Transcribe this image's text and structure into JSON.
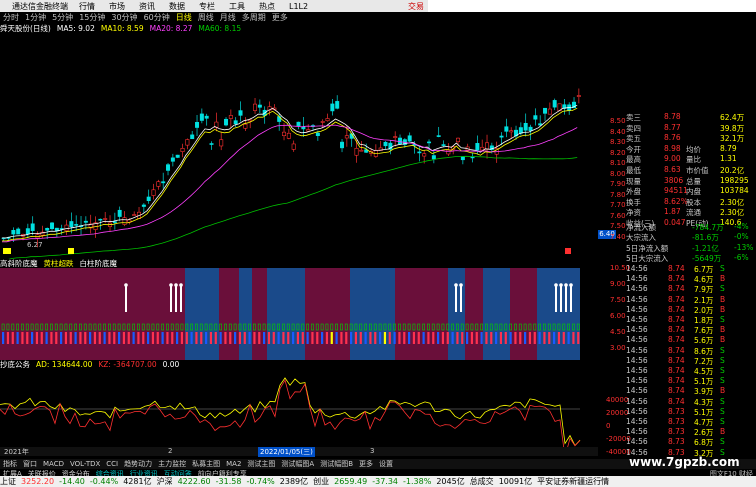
{
  "menubar": {
    "logo": "通达信金融终端",
    "items": [
      "行情",
      "市场",
      "资讯",
      "数据",
      "专栏",
      "工具",
      "热点",
      "L1L2"
    ],
    "login": "交易"
  },
  "periods": [
    "分时",
    "1分钟",
    "5分钟",
    "15分钟",
    "30分钟",
    "60分钟",
    "日线",
    "周线",
    "月线",
    "多周期",
    "更多"
  ],
  "active_period": "日线",
  "stock": {
    "title": "舜天股份(日线)",
    "ma5": "MA5: 9.02",
    "ma10": "MA10: 8.59",
    "ma20": "MA20: 8.27",
    "ma60": "MA60: 8.15",
    "low_label": "6.27"
  },
  "price_axis": [
    "8.50",
    "8.40",
    "8.30",
    "8.20",
    "8.10",
    "8.00",
    "7.90",
    "7.80",
    "7.70",
    "7.60",
    "7.50",
    "7.40"
  ],
  "last_price_tag": "6.40",
  "indicator1": {
    "title": "高斜阶底魔",
    "legend1": "黄柱超跌",
    "legend2": "白柱阶底魔",
    "axis": [
      "10.50",
      "9.00",
      "7.50",
      "6.00",
      "4.50",
      "3.00"
    ]
  },
  "indicator2": {
    "title": "抄底公务",
    "ad": "AD: 134644.00",
    "adz": "KZ: -364707.00",
    "z": "0.00",
    "axis": [
      "40000",
      "20000",
      "0",
      "-20000",
      "-40000"
    ]
  },
  "date_axis": [
    "2021年",
    "2",
    "2022/01/05(三)",
    "3"
  ],
  "quote": {
    "rows": [
      {
        "l": "卖三",
        "v": "8.78",
        "r": "",
        "n": "62.4万"
      },
      {
        "l": "卖四",
        "v": "8.77",
        "r": "",
        "n": "39.8万"
      },
      {
        "l": "卖五",
        "v": "8.76",
        "r": "",
        "n": "32.1万"
      },
      {
        "l": "今开",
        "v": "8.98",
        "r": "均价",
        "n": "8.79"
      },
      {
        "l": "最高",
        "v": "9.00",
        "r": "量比",
        "n": "1.31"
      },
      {
        "l": "最低",
        "v": "8.63",
        "r": "市价值",
        "n": "20.2亿"
      },
      {
        "l": "现量",
        "v": "3806",
        "r": "总量",
        "n": "198295"
      },
      {
        "l": "外盘",
        "v": "94511",
        "r": "内盘",
        "n": "103784"
      },
      {
        "l": "换手",
        "v": "8.62%",
        "r": "股本",
        "n": "2.30亿"
      },
      {
        "l": "净资",
        "v": "1.87",
        "r": "流通",
        "n": "2.30亿"
      },
      {
        "l": "收益(三)",
        "v": "0.047",
        "r": "PE(动)",
        "n": "140.6"
      }
    ],
    "flows": [
      {
        "l": "净流入额",
        "v": "-784.7万",
        "p": "-4%"
      },
      {
        "l": "大宗流入",
        "v": "-81.6万",
        "p": "-0%"
      },
      {
        "l": "5日净流入额",
        "v": "-1.21亿",
        "p": "-13%"
      },
      {
        "l": "5日大宗流入",
        "v": "-5649万",
        "p": "-6%"
      }
    ],
    "ticks": [
      {
        "t": "14:56",
        "p": "8.74",
        "v": "6.7万",
        "d": "S"
      },
      {
        "t": "14:56",
        "p": "8.74",
        "v": "4.6万",
        "d": "B"
      },
      {
        "t": "14:56",
        "p": "8.74",
        "v": "7.9万",
        "d": "S"
      },
      {
        "t": "14:56",
        "p": "8.74",
        "v": "2.1万",
        "d": "B"
      },
      {
        "t": "14:56",
        "p": "8.74",
        "v": "2.0万",
        "d": "B"
      },
      {
        "t": "14:56",
        "p": "8.74",
        "v": "1.8万",
        "d": "S"
      },
      {
        "t": "14:56",
        "p": "8.74",
        "v": "7.6万",
        "d": "B"
      },
      {
        "t": "14:56",
        "p": "8.74",
        "v": "5.6万",
        "d": "B"
      },
      {
        "t": "14:56",
        "p": "8.74",
        "v": "8.6万",
        "d": "S"
      },
      {
        "t": "14:56",
        "p": "8.74",
        "v": "7.2万",
        "d": "S"
      },
      {
        "t": "14:56",
        "p": "8.74",
        "v": "4.5万",
        "d": "S"
      },
      {
        "t": "14:56",
        "p": "8.74",
        "v": "5.1万",
        "d": "S"
      },
      {
        "t": "14:56",
        "p": "8.74",
        "v": "3.9万",
        "d": "B"
      },
      {
        "t": "14:56",
        "p": "8.74",
        "v": "4.3万",
        "d": "S"
      },
      {
        "t": "14:56",
        "p": "8.73",
        "v": "5.1万",
        "d": "S"
      },
      {
        "t": "14:56",
        "p": "8.73",
        "v": "4.7万",
        "d": "S"
      },
      {
        "t": "14:56",
        "p": "8.73",
        "v": "2.6万",
        "d": "B"
      },
      {
        "t": "14:56",
        "p": "8.73",
        "v": "6.8万",
        "d": "S"
      },
      {
        "t": "14:56",
        "p": "8.73",
        "v": "3.2万",
        "d": "S"
      }
    ]
  },
  "taskbar": [
    "指标",
    "窗口",
    "MACD",
    "VOL-TDX",
    "CCI",
    "趋势动力",
    "主力监控",
    "私募主图",
    "MA2",
    "测试主图",
    "测试幅图A",
    "测试幅图B",
    "更多",
    "设置"
  ],
  "taskbar2": [
    "扩展A",
    "关联报价",
    "资金分布",
    "综合资讯",
    "行业资讯",
    "互动问答",
    "前向户籍利专享"
  ],
  "taskbar2_right": "图文F10 财经",
  "status": {
    "sh_name": "上证",
    "sh": "3252.20",
    "sh_chg": "-14.40",
    "sh_pct": "-0.44%",
    "sh_amt": "4281亿",
    "hs_name": "沪深",
    "hs": "4222.60",
    "hs_chg": "-31.58",
    "hs_pct": "-0.74%",
    "hs_amt": "2389亿",
    "cy_name": "创业",
    "cy": "2659.49",
    "cy_chg": "-37.34",
    "cy_pct": "-1.38%",
    "cy_amt": "2045亿",
    "total_label": "总成交",
    "total": "10091亿",
    "msg": "平安证券新疆运行情"
  },
  "watermark": "www.7gpzb.com",
  "colors": {
    "up": "#ff3030",
    "down": "#00cc00",
    "ma5": "#ffffff",
    "ma10": "#ffff00",
    "ma20": "#ff40ff",
    "ma60": "#00c000",
    "band1": "#6a0f3a",
    "band2": "#1a4a8a"
  }
}
